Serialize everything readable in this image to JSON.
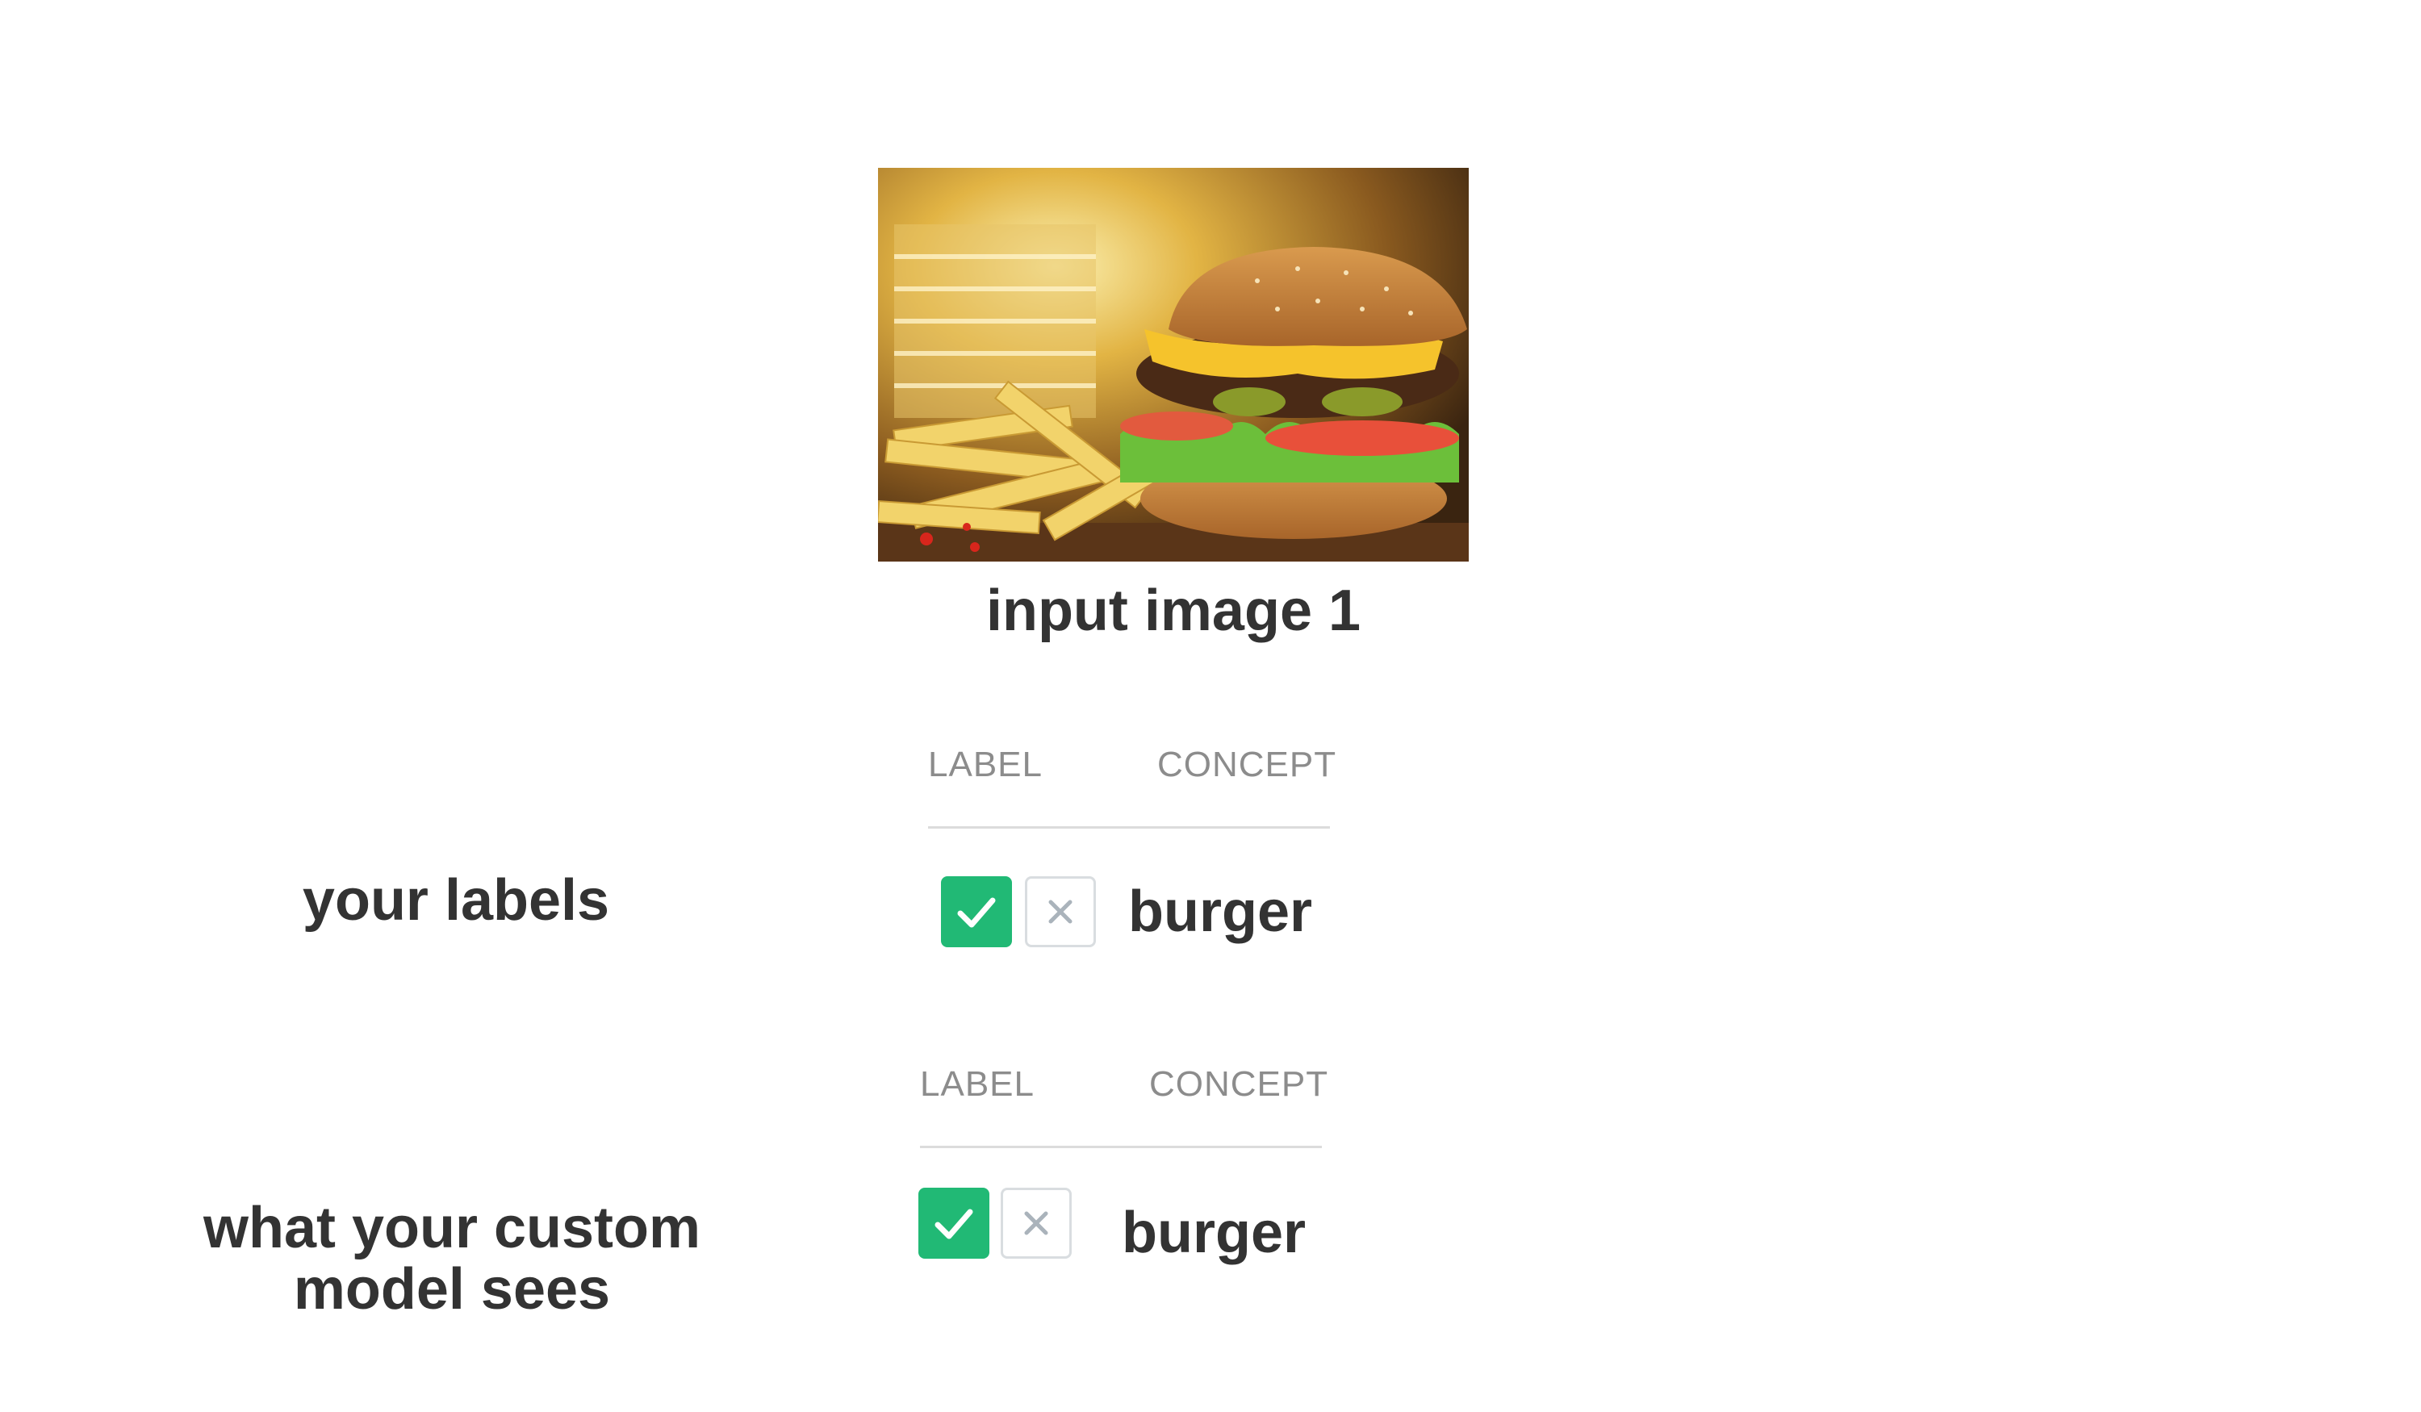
{
  "input_image": {
    "caption": "input image 1",
    "subject": "burger with fries"
  },
  "sections": [
    {
      "row_label": "your labels",
      "header_label": "LABEL",
      "header_concept": "CONCEPT",
      "concept": "burger",
      "label_state": "positive"
    },
    {
      "row_label": "what your custom model sees",
      "header_label": "LABEL",
      "header_concept": "CONCEPT",
      "concept": "burger",
      "label_state": "positive"
    }
  ],
  "colors": {
    "check_green": "#21b975",
    "x_gray": "#aab3bb",
    "text_dark": "#333333",
    "header_gray": "#8c8c8c"
  },
  "icons": {
    "check": "checkmark-icon",
    "cross": "close-icon"
  }
}
